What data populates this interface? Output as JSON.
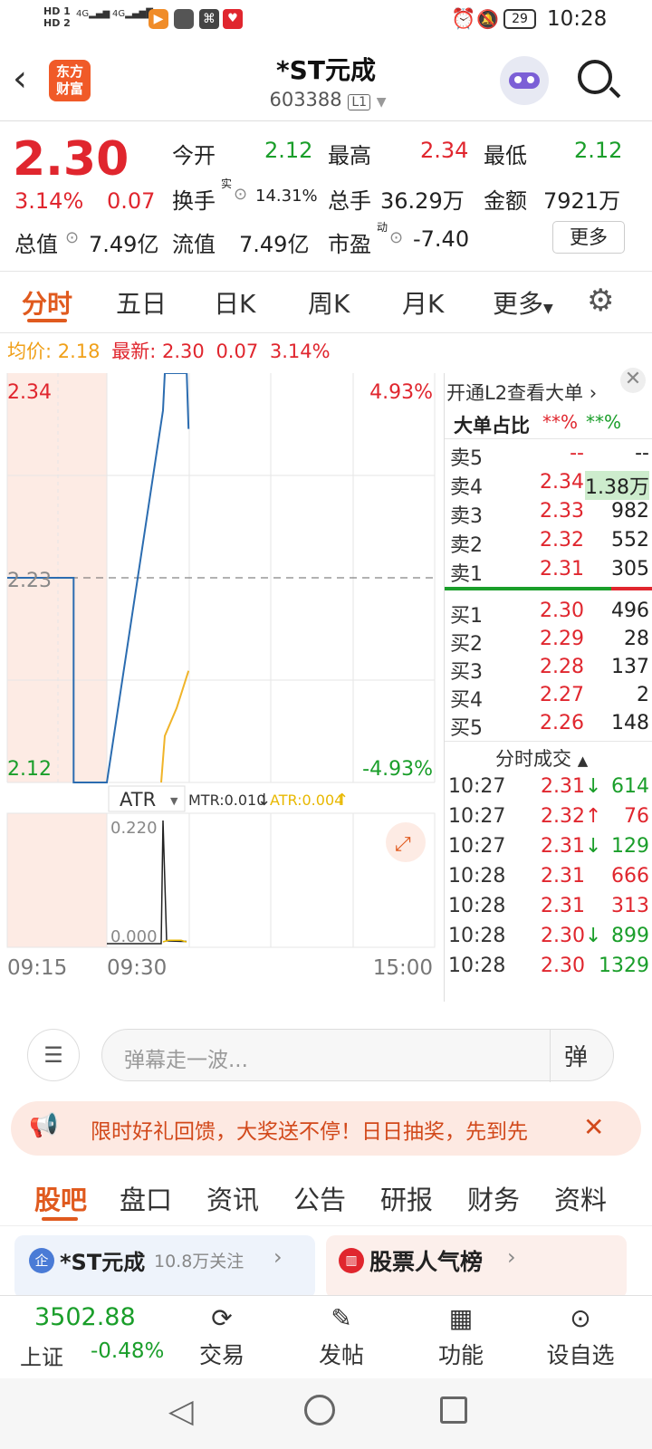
{
  "status_bar": {
    "sim1": "HD 1",
    "sim2": "HD 2",
    "net1": "4G",
    "net2": "4G",
    "battery": "29",
    "time": "10:28"
  },
  "header": {
    "brand_logo": "东方财富",
    "stock_name": "*ST元成",
    "stock_code": "603388",
    "level_badge": "L1"
  },
  "quote": {
    "price": "2.30",
    "change_pct": "3.14%",
    "change_amt": "0.07",
    "open_label": "今开",
    "open": "2.12",
    "high_label": "最高",
    "high": "2.34",
    "low_label": "最低",
    "low": "2.12",
    "turnover_rate_label": "换手",
    "turnover_rate_sup": "实",
    "turnover_rate": "14.31%",
    "volume_label": "总手",
    "volume": "36.29万",
    "amount_label": "金额",
    "amount": "7921万",
    "total_cap_label": "总值",
    "total_cap": "7.49亿",
    "float_cap_label": "流值",
    "float_cap": "7.49亿",
    "pe_label": "市盈",
    "pe_sup": "动",
    "pe": "-7.40",
    "more_button": "更多"
  },
  "tabs": [
    "分时",
    "五日",
    "日K",
    "周K",
    "月K",
    "更多"
  ],
  "avg_line": {
    "avg_label": "均价:",
    "avg": "2.18",
    "latest_label": "最新:",
    "latest": "2.30",
    "chg": "0.07",
    "pct": "3.14%"
  },
  "chart": {
    "y_top": "2.34",
    "y_mid": "2.23",
    "y_bot": "2.12",
    "pct_top": "4.93%",
    "pct_bot": "-4.93%",
    "indicator": "ATR",
    "mtr_label": "MTR:0.010",
    "atr_label": "ATR:0.004",
    "atr_top": "0.220",
    "atr_bot": "0.000",
    "time_start": "09:15",
    "time_open": "09:30",
    "time_end": "15:00"
  },
  "chart_data": {
    "type": "line",
    "series": [
      {
        "name": "price",
        "color": "#2b6cb0",
        "points": [
          [
            "09:15",
            2.23
          ],
          [
            "09:25",
            2.23
          ],
          [
            "09:25",
            2.12
          ],
          [
            "09:30",
            2.12
          ],
          [
            "09:30",
            2.32
          ],
          [
            "09:30",
            2.34
          ],
          [
            "09:31",
            2.34
          ],
          [
            "09:32",
            2.34
          ],
          [
            "09:32",
            2.31
          ]
        ]
      },
      {
        "name": "avg",
        "color": "#f0b429",
        "points": [
          [
            "09:30",
            2.12
          ],
          [
            "09:30",
            2.145
          ],
          [
            "09:31",
            2.16
          ],
          [
            "09:32",
            2.18
          ]
        ]
      }
    ],
    "ylim": [
      2.12,
      2.34
    ],
    "atr_values": [
      0.22,
      0.005,
      0.004,
      0.004
    ]
  },
  "order_book": {
    "l2_promo": "开通L2查看大单",
    "big_ratio_label": "大单占比",
    "big_ratio_a": "**%",
    "big_ratio_b": "**%",
    "asks": [
      {
        "label": "卖5",
        "price": "--",
        "vol": "--"
      },
      {
        "label": "卖4",
        "price": "2.34",
        "vol": "1.38万"
      },
      {
        "label": "卖3",
        "price": "2.33",
        "vol": "982"
      },
      {
        "label": "卖2",
        "price": "2.32",
        "vol": "552"
      },
      {
        "label": "卖1",
        "price": "2.31",
        "vol": "305"
      }
    ],
    "bids": [
      {
        "label": "买1",
        "price": "2.30",
        "vol": "496"
      },
      {
        "label": "买2",
        "price": "2.29",
        "vol": "28"
      },
      {
        "label": "买3",
        "price": "2.28",
        "vol": "137"
      },
      {
        "label": "买4",
        "price": "2.27",
        "vol": "2"
      },
      {
        "label": "买5",
        "price": "2.26",
        "vol": "148"
      }
    ],
    "ticks_title": "分时成交",
    "ticks": [
      {
        "time": "10:27",
        "price": "2.31",
        "arrow": "↓",
        "vol": "614",
        "color": "red",
        "vcolor": "green"
      },
      {
        "time": "10:27",
        "price": "2.32",
        "arrow": "↑",
        "vol": "76",
        "color": "red",
        "vcolor": "red"
      },
      {
        "time": "10:27",
        "price": "2.31",
        "arrow": "↓",
        "vol": "129",
        "color": "red",
        "vcolor": "green"
      },
      {
        "time": "10:28",
        "price": "2.31",
        "arrow": "",
        "vol": "666",
        "color": "red",
        "vcolor": "red"
      },
      {
        "time": "10:28",
        "price": "2.31",
        "arrow": "",
        "vol": "313",
        "color": "red",
        "vcolor": "red"
      },
      {
        "time": "10:28",
        "price": "2.30",
        "arrow": "↓",
        "vol": "899",
        "color": "red",
        "vcolor": "green"
      },
      {
        "time": "10:28",
        "price": "2.30",
        "arrow": "",
        "vol": "1329",
        "color": "red",
        "vcolor": "green"
      }
    ]
  },
  "danmu": {
    "placeholder": "弹幕走一波...",
    "send_icon": "弹"
  },
  "banner": {
    "text": "限时好礼回馈，大奖送不停！日日抽奖，先到先"
  },
  "sub_tabs": [
    "股吧",
    "盘口",
    "资讯",
    "公告",
    "研报",
    "财务",
    "资料"
  ],
  "cards": [
    {
      "badge": "企",
      "title": "*ST元成",
      "followers": "10.8万关注"
    },
    {
      "title": "股票人气榜"
    }
  ],
  "bottom_nav": {
    "index_value": "3502.88",
    "index_name": "上证",
    "index_pct": "-0.48%",
    "items": [
      "交易",
      "发帖",
      "功能",
      "设自选"
    ]
  }
}
